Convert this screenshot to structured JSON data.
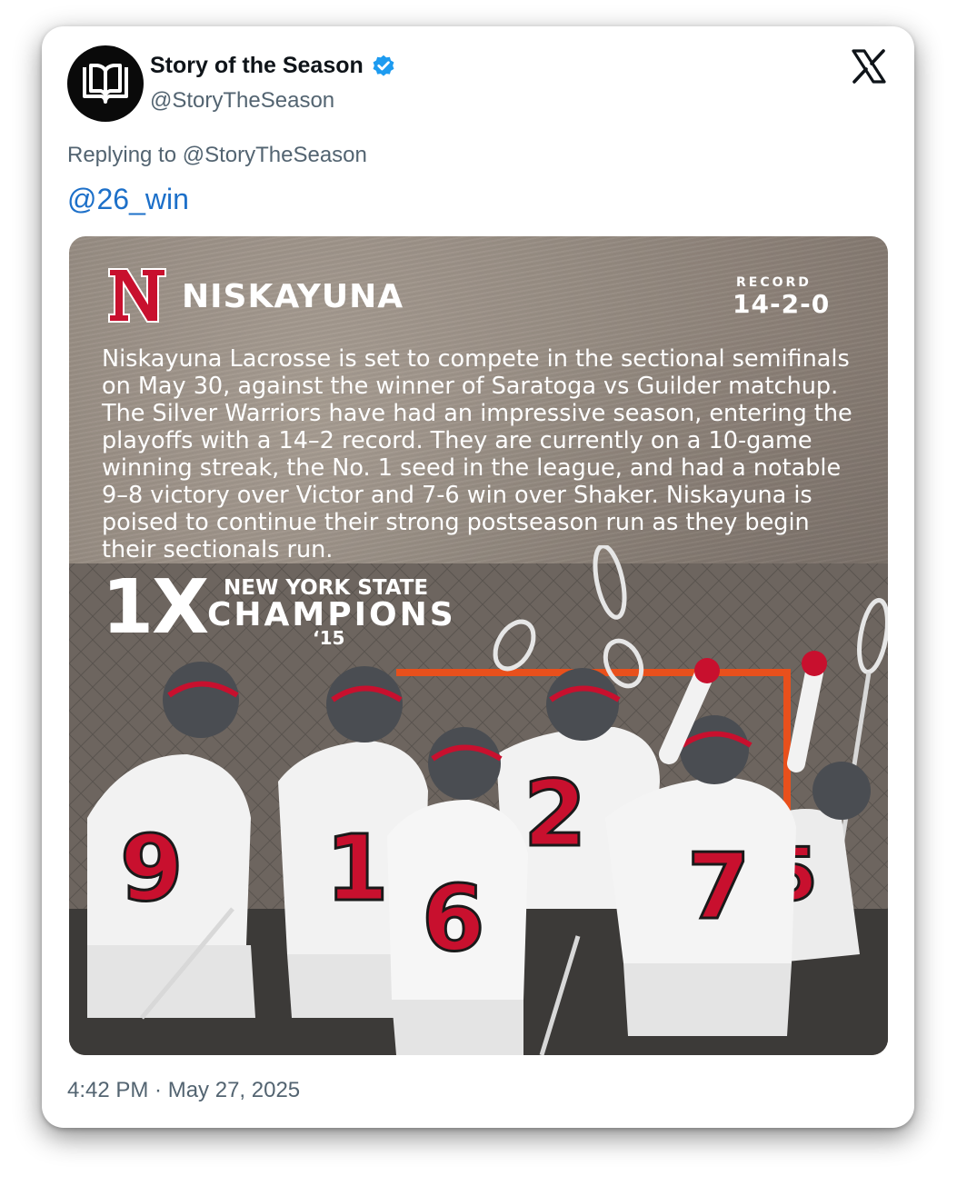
{
  "author": {
    "display_name": "Story of the Season",
    "handle": "@StoryTheSeason",
    "verified": true,
    "avatar_icon": "open-book-icon"
  },
  "platform_icon": "x-logo-icon",
  "reply": {
    "replying_to": "Replying to @StoryTheSeason",
    "mention": "@26_win"
  },
  "media": {
    "logo_letter": "N",
    "school": "NISKAYUNA",
    "record_label": "RECORD",
    "record_value": "14-2-0",
    "story": "Niskayuna Lacrosse is set to compete in the sectional semifinals on May 30, against the winner of Saratoga vs Guilder matchup. The Silver Warriors have had an impressive season, entering the playoffs with a 14–2 record. They are currently on a 10-game winning streak, the No. 1 seed in the league, and had a notable 9–8 victory over Victor and 7-6 win over Shaker. Niskayuna is poised to continue their strong postseason run as they begin their sectionals run.",
    "champ_count": "1X",
    "champ_line1": "NEW YORK STATE",
    "champ_line2": "CHAMPIONS",
    "champ_year": "‘15",
    "jersey_numbers": [
      "9",
      "1",
      "6",
      "2",
      "7",
      "5"
    ],
    "colors": {
      "brand_red": "#c8102e",
      "jersey_white": "#f2f2f2",
      "helmet_gray": "#4a4d52",
      "goal_orange": "#e8501c"
    }
  },
  "timestamp": "4:42 PM · May 27, 2025",
  "colors": {
    "link_blue": "#1d70c9",
    "verified_blue": "#1d9bf0",
    "secondary_text": "#536471"
  }
}
